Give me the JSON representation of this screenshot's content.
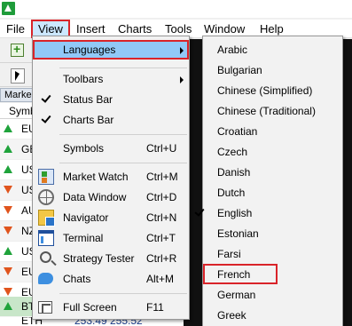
{
  "menubar": {
    "items": [
      {
        "label": "File"
      },
      {
        "label": "View"
      },
      {
        "label": "Insert"
      },
      {
        "label": "Charts"
      },
      {
        "label": "Tools"
      },
      {
        "label": "Window"
      },
      {
        "label": "Help"
      }
    ],
    "active": "View"
  },
  "market_watch": {
    "title": "Marke",
    "column_header": "Symb",
    "rows": [
      {
        "symbol": "EU",
        "direction": "up"
      },
      {
        "symbol": "GB",
        "direction": "up"
      },
      {
        "symbol": "US",
        "direction": "up"
      },
      {
        "symbol": "US",
        "direction": "down"
      },
      {
        "symbol": "AU",
        "direction": "down"
      },
      {
        "symbol": "NZ",
        "direction": "down"
      },
      {
        "symbol": "US",
        "direction": "up"
      },
      {
        "symbol": "EU",
        "direction": "down"
      },
      {
        "symbol": "EU",
        "direction": "down"
      },
      {
        "symbol": "EU",
        "direction": "up"
      },
      {
        "symbol": "BT",
        "direction": "up"
      }
    ],
    "partial_row": {
      "symbol": "ETH",
      "bid": "253.49",
      "ask": "255.52"
    }
  },
  "view_menu": {
    "languages": "Languages",
    "toolbars": "Toolbars",
    "status_bar": "Status Bar",
    "charts_bar": "Charts Bar",
    "symbols": "Symbols",
    "symbols_shortcut": "Ctrl+U",
    "market_watch": "Market Watch",
    "market_watch_shortcut": "Ctrl+M",
    "data_window": "Data Window",
    "data_window_shortcut": "Ctrl+D",
    "navigator": "Navigator",
    "navigator_shortcut": "Ctrl+N",
    "terminal": "Terminal",
    "terminal_shortcut": "Ctrl+T",
    "strategy_tester": "Strategy Tester",
    "strategy_tester_shortcut": "Ctrl+R",
    "chats": "Chats",
    "chats_shortcut": "Alt+M",
    "full_screen": "Full Screen",
    "full_screen_shortcut": "F11"
  },
  "languages_menu": {
    "items": [
      "Arabic",
      "Bulgarian",
      "Chinese (Simplified)",
      "Chinese (Traditional)",
      "Croatian",
      "Czech",
      "Danish",
      "Dutch",
      "English",
      "Estonian",
      "Farsi",
      "French",
      "German",
      "Greek"
    ],
    "checked": "English",
    "boxed": "French"
  },
  "colors": {
    "highlight_border": "#d9242a",
    "selection_blue": "#91c9f7",
    "arrow_up": "#1fa33b",
    "arrow_down": "#e0541d"
  }
}
